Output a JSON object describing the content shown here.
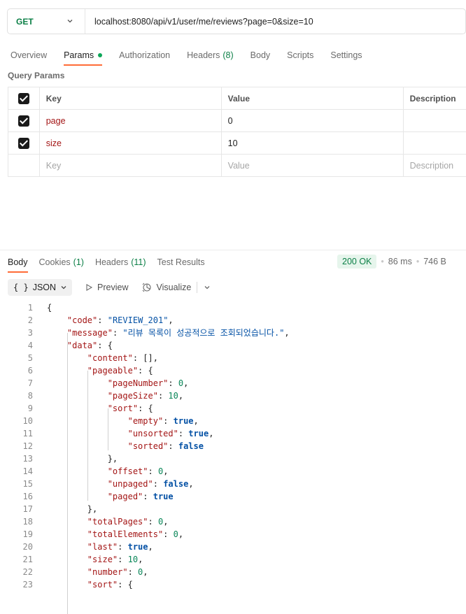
{
  "request": {
    "method": "GET",
    "url": "localhost:8080/api/v1/user/me/reviews?page=0&size=10",
    "tabs": [
      {
        "label": "Overview"
      },
      {
        "label": "Params"
      },
      {
        "label": "Authorization"
      },
      {
        "label": "Headers",
        "count": "(8)"
      },
      {
        "label": "Body"
      },
      {
        "label": "Scripts"
      },
      {
        "label": "Settings"
      }
    ]
  },
  "query_params": {
    "title": "Query Params",
    "headers": {
      "key": "Key",
      "value": "Value",
      "description": "Description"
    },
    "rows": [
      {
        "key": "page",
        "value": "0"
      },
      {
        "key": "size",
        "value": "10"
      }
    ],
    "placeholder": {
      "key": "Key",
      "value": "Value",
      "description": "Description"
    }
  },
  "response": {
    "tabs": [
      {
        "label": "Body"
      },
      {
        "label": "Cookies",
        "count": "(1)"
      },
      {
        "label": "Headers",
        "count": "(11)"
      },
      {
        "label": "Test Results"
      }
    ],
    "status": "200 OK",
    "time": "86 ms",
    "size": "746 B",
    "format": "JSON",
    "preview_label": "Preview",
    "visualize_label": "Visualize"
  },
  "code_lines": [
    {
      "n": "1",
      "t": "{"
    },
    {
      "n": "2",
      "t": "    \"code\": \"REVIEW_201\","
    },
    {
      "n": "3",
      "t": "    \"message\": \"리뷰 목록이 성공적으로 조회되었습니다.\","
    },
    {
      "n": "4",
      "t": "    \"data\": {"
    },
    {
      "n": "5",
      "t": "        \"content\": [],"
    },
    {
      "n": "6",
      "t": "        \"pageable\": {"
    },
    {
      "n": "7",
      "t": "            \"pageNumber\": 0,"
    },
    {
      "n": "8",
      "t": "            \"pageSize\": 10,"
    },
    {
      "n": "9",
      "t": "            \"sort\": {"
    },
    {
      "n": "10",
      "t": "                \"empty\": true,"
    },
    {
      "n": "11",
      "t": "                \"unsorted\": true,"
    },
    {
      "n": "12",
      "t": "                \"sorted\": false"
    },
    {
      "n": "13",
      "t": "            },"
    },
    {
      "n": "14",
      "t": "            \"offset\": 0,"
    },
    {
      "n": "15",
      "t": "            \"unpaged\": false,"
    },
    {
      "n": "16",
      "t": "            \"paged\": true"
    },
    {
      "n": "17",
      "t": "        },"
    },
    {
      "n": "18",
      "t": "        \"totalPages\": 0,"
    },
    {
      "n": "19",
      "t": "        \"totalElements\": 0,"
    },
    {
      "n": "20",
      "t": "        \"last\": true,"
    },
    {
      "n": "21",
      "t": "        \"size\": 10,"
    },
    {
      "n": "22",
      "t": "        \"number\": 0,"
    },
    {
      "n": "23",
      "t": "        \"sort\": {"
    }
  ]
}
